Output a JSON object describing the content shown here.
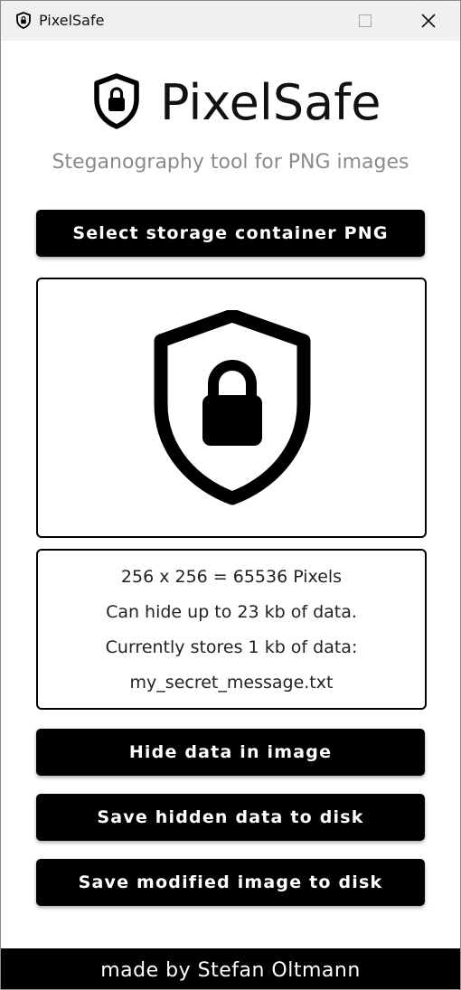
{
  "window": {
    "title": "PixelSafe",
    "controls": {
      "minimize_icon": "minimize-icon",
      "maximize_icon": "maximize-icon",
      "close_icon": "close-icon"
    }
  },
  "header": {
    "logo_icon": "shield-lock-icon",
    "title": "PixelSafe",
    "subtitle": "Steganography tool for PNG images"
  },
  "buttons": {
    "select": "Select storage container PNG",
    "hide": "Hide data in image",
    "save_data": "Save hidden data to disk",
    "save_image": "Save modified image to disk"
  },
  "preview": {
    "icon": "shield-lock-icon"
  },
  "info": {
    "dimensions": "256 x 256 = 65536 Pixels",
    "capacity": "Can hide up to 23 kb of data.",
    "current": "Currently stores 1 kb of data:",
    "filename": "my_secret_message.txt"
  },
  "footer": {
    "credit": "made by Stefan Oltmann"
  },
  "colors": {
    "primary": "#000000",
    "background": "#ffffff",
    "subtitle": "#8a8a8a",
    "titlebar": "#f0f0f0"
  }
}
